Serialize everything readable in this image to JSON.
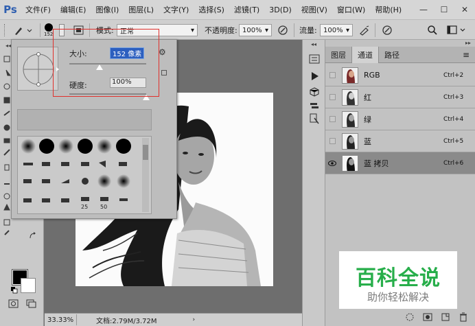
{
  "app": {
    "logo": "Ps"
  },
  "menu": [
    "文件(F)",
    "编辑(E)",
    "图像(I)",
    "图层(L)",
    "文字(Y)",
    "选择(S)",
    "滤镜(T)",
    "3D(D)",
    "视图(V)",
    "窗口(W)",
    "帮助(H)"
  ],
  "window_controls": {
    "minimize": "—",
    "maximize": "☐",
    "close": "✕"
  },
  "options": {
    "brush_size_value": "152",
    "mode_label": "模式:",
    "mode_value": "正常",
    "opacity_label": "不透明度:",
    "opacity_value": "100%",
    "flow_label": "流量:",
    "flow_value": "100%"
  },
  "brush_popup": {
    "size_label": "大小:",
    "size_value": "152 像素",
    "hardness_label": "硬度:",
    "hardness_value": "100%",
    "size_fraction": 0.3,
    "hardness_fraction": 1.0,
    "preset_size_labels": [
      "25",
      "50"
    ]
  },
  "panels": {
    "tabs": [
      "图层",
      "通道",
      "路径"
    ],
    "active_tab": "通道",
    "channels": [
      {
        "name": "RGB",
        "shortcut": "Ctrl+2",
        "visible": false,
        "selected": false
      },
      {
        "name": "红",
        "shortcut": "Ctrl+3",
        "visible": false,
        "selected": false
      },
      {
        "name": "绿",
        "shortcut": "Ctrl+4",
        "visible": false,
        "selected": false
      },
      {
        "name": "蓝",
        "shortcut": "Ctrl+5",
        "visible": false,
        "selected": false
      },
      {
        "name": "蓝 拷贝",
        "shortcut": "Ctrl+6",
        "visible": true,
        "selected": true
      }
    ]
  },
  "status": {
    "zoom": "33.33%",
    "doc_info": "文档:2.79M/3.72M"
  },
  "watermark": {
    "title": "百科全说",
    "subtitle": "助你轻松解决"
  },
  "colors": {
    "foreground": "#000000",
    "background": "#ffffff",
    "selection_box": "#e0302c",
    "watermark_green": "#27ae4a"
  }
}
